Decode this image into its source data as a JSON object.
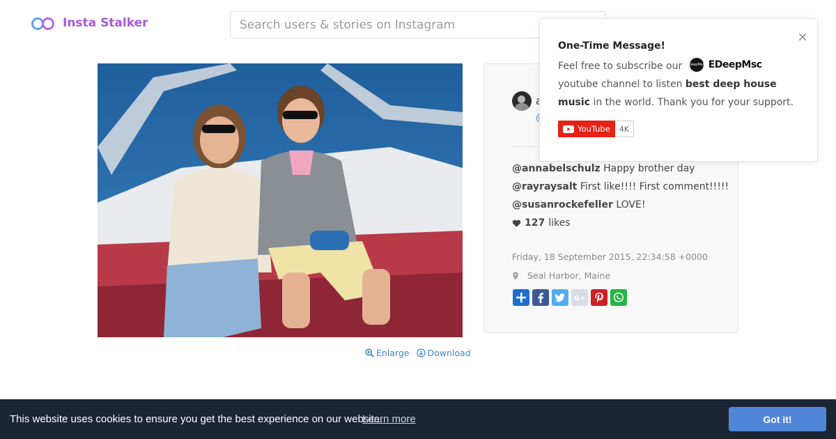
{
  "header": {
    "logo_text": "Insta Stalker",
    "search_placeholder": "Search users & stories on Instagram"
  },
  "media": {
    "enlarge_label": "Enlarge",
    "download_label": "Download"
  },
  "post": {
    "username": "a",
    "handle": "@",
    "comments": [
      {
        "user": "@annabelschulz",
        "text": "Happy brother day"
      },
      {
        "user": "@rayraysalt",
        "text": "First like!!!! First comment!!!!!"
      },
      {
        "user": "@susanrockefeller",
        "text": "LOVE!"
      }
    ],
    "likes_count": "127",
    "likes_label": "likes",
    "timestamp": "Friday, 18 September 2015, 22:34:58 +0000",
    "location": "Seal Harbor, Maine",
    "share_buttons": [
      "share",
      "facebook",
      "twitter",
      "google-plus",
      "pinterest",
      "whatsapp"
    ]
  },
  "popup": {
    "title": "One-Time Message!",
    "body_prefix": "Feel free to subscribe our",
    "brand_logo_text": "DeepMsc",
    "brand_name": "EDeepMsc",
    "body_mid": "youtube channel to listen",
    "body_bold": "best deep house music",
    "body_suffix": "in the world. Thank you for your support.",
    "close": "×",
    "youtube_label": "YouTube",
    "youtube_count": "4K"
  },
  "cookie": {
    "message": "This website uses cookies to ensure you get the best experience on our website.",
    "learn_more": "Learn more",
    "button": "Got it!"
  },
  "colors": {
    "brand": "#a45bd8",
    "link": "#3d86c8",
    "cookie_bg": "#1c2534",
    "cookie_button": "#4f86d8",
    "youtube_red": "#e62117"
  }
}
